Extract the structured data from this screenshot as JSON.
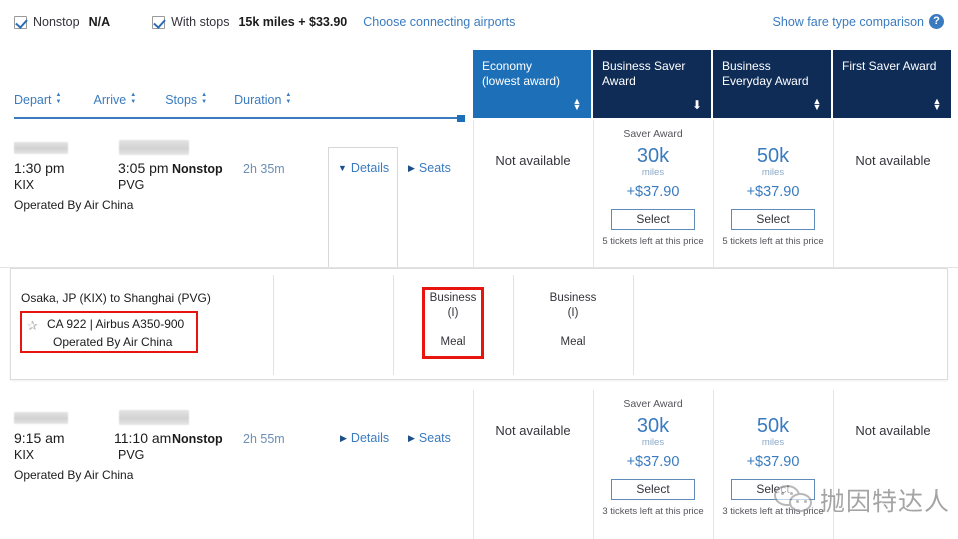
{
  "filters": {
    "nonstop": {
      "label": "Nonstop",
      "value": "N/A",
      "checked": true
    },
    "withstops": {
      "label": "With stops",
      "value": "15k miles + $33.90",
      "checked": true
    },
    "connecting_link": "Choose connecting airports"
  },
  "fare_comparison": {
    "label": "Show fare type comparison",
    "help_icon": "question-mark-icon",
    "help_glyph": "?"
  },
  "award_columns": [
    {
      "line1": "Economy",
      "line2": "(lowest award)",
      "active": true,
      "sort": "both"
    },
    {
      "line1": "Business Saver",
      "line2": "Award",
      "active": false,
      "sort": "down"
    },
    {
      "line1": "Business",
      "line2": "Everyday Award",
      "active": false,
      "sort": "both"
    },
    {
      "line1": "First Saver Award",
      "line2": "",
      "active": false,
      "sort": "both"
    }
  ],
  "sort_row": [
    {
      "label": "Depart"
    },
    {
      "label": "Arrive"
    },
    {
      "label": "Stops"
    },
    {
      "label": "Duration"
    }
  ],
  "flights": [
    {
      "depart_time": "1:30 pm",
      "depart_airport": "KIX",
      "arrive_time": "3:05 pm",
      "arrive_airport": "PVG",
      "stops": "Nonstop",
      "duration": "2h 35m",
      "operated_by": "Operated By Air China",
      "details_label": "Details",
      "seats_label": "Seats",
      "details_expanded": true,
      "saver_label": "Saver Award",
      "awards": [
        {
          "type": "unavailable",
          "text": "Not available"
        },
        {
          "type": "available",
          "miles": "30k",
          "miles_unit": "miles",
          "cash": "+$37.90",
          "select": "Select",
          "tickets_left": "5 tickets left at this price"
        },
        {
          "type": "available",
          "miles": "50k",
          "miles_unit": "miles",
          "cash": "+$37.90",
          "select": "Select",
          "tickets_left": "5 tickets left at this price"
        },
        {
          "type": "unavailable",
          "text": "Not available"
        }
      ]
    },
    {
      "depart_time": "9:15 am",
      "depart_airport": "KIX",
      "arrive_time": "11:10 am",
      "arrive_airport": "PVG",
      "stops": "Nonstop",
      "duration": "2h 55m",
      "operated_by": "Operated By Air China",
      "details_label": "Details",
      "seats_label": "Seats",
      "details_expanded": false,
      "saver_label": "Saver Award",
      "awards": [
        {
          "type": "unavailable",
          "text": "Not available"
        },
        {
          "type": "available",
          "miles": "30k",
          "miles_unit": "miles",
          "cash": "+$37.90",
          "select": "Select",
          "tickets_left": "3 tickets left at this price"
        },
        {
          "type": "available",
          "miles": "50k",
          "miles_unit": "miles",
          "cash": "+$37.90",
          "select": "Select",
          "tickets_left": "3 tickets left at this price"
        },
        {
          "type": "unavailable",
          "text": "Not available"
        }
      ]
    }
  ],
  "detail_panel": {
    "route": "Osaka, JP (KIX) to Shanghai (PVG)",
    "flight_number": "CA 922 | Airbus A350-900",
    "operated_by": "Operated By Air China",
    "star_icon": "star-icon",
    "star_glyph": "✰",
    "cabins": [
      {
        "name": "Business",
        "code": "(I)",
        "meal": "Meal",
        "highlighted": true
      },
      {
        "name": "Business",
        "code": "(I)",
        "meal": "Meal",
        "highlighted": false
      }
    ]
  },
  "watermark": {
    "text": "抛因特达人",
    "logo": "wechat-logo"
  },
  "colors": {
    "header_navy": "#0e2c56",
    "header_active_blue": "#1d70b8",
    "link_blue": "#3a7bbf",
    "highlight_red": "#e8150f",
    "miles_blue": "#3a7bbf"
  }
}
